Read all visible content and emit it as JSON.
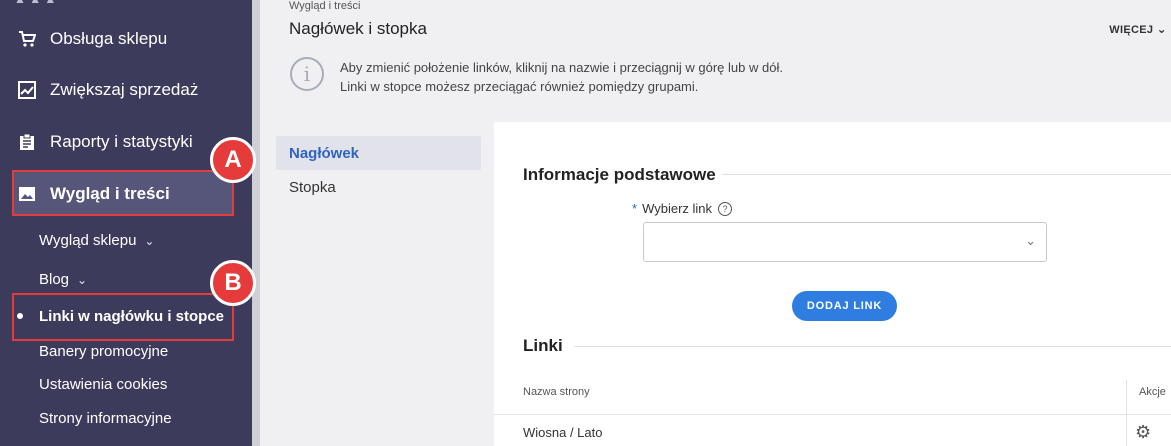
{
  "sidebar": {
    "items": [
      {
        "label": "Obsługa sklepu",
        "icon": "cart-icon"
      },
      {
        "label": "Zwiększaj sprzedaż",
        "icon": "chart-icon"
      },
      {
        "label": "Raporty i statystyki",
        "icon": "clipboard-icon"
      },
      {
        "label": "Wygląd i treści",
        "icon": "image-icon"
      }
    ],
    "subitems": [
      {
        "label": "Wygląd sklepu"
      },
      {
        "label": "Blog"
      },
      {
        "label": "Linki w nagłówku i stopce"
      },
      {
        "label": "Banery promocyjne"
      },
      {
        "label": "Ustawienia cookies"
      },
      {
        "label": "Strony informacyjne"
      }
    ]
  },
  "annotations": {
    "a": "A",
    "b": "B",
    "color": "#e53b3b"
  },
  "header": {
    "breadcrumb": "Wygląd i treści",
    "title": "Nagłówek i stopka",
    "more": "WIĘCEJ"
  },
  "info": {
    "line1": "Aby zmienić położenie linków, kliknij na nazwie i przeciągnij w górę lub w dół.",
    "line2": "Linki w stopce możesz przeciągać również pomiędzy grupami."
  },
  "tabs": [
    {
      "label": "Nagłówek"
    },
    {
      "label": "Stopka"
    }
  ],
  "form": {
    "section_title": "Informacje podstawowe",
    "required_mark": "*",
    "field_label": "Wybierz link",
    "help": "?",
    "add_button": "DODAJ LINK"
  },
  "links": {
    "section_title": "Linki",
    "col_name": "Nazwa strony",
    "col_actions": "Akcje",
    "rows": [
      {
        "name": "Wiosna / Lato"
      }
    ]
  },
  "colors": {
    "sidebar": "#3d3b5c",
    "accent": "#2f7de1",
    "tab_active": "#2f63c0"
  }
}
